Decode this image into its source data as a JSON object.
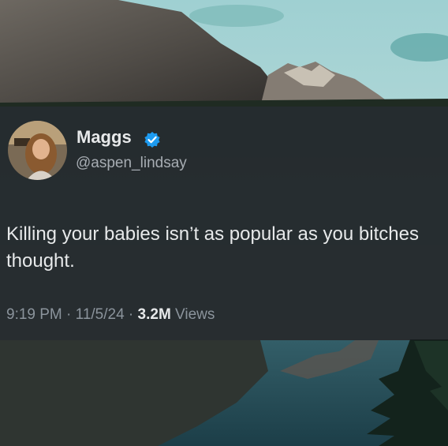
{
  "tweet": {
    "display_name": "Maggs",
    "handle": "@aspen_lindsay",
    "text": "Killing your babies isn’t as popular as you bitches thought.",
    "time": "9:19 PM",
    "date": "11/5/24",
    "separator": " · ",
    "views_count": "3.2M",
    "views_label": " Views",
    "verified_badge_icon": "verified-check-icon",
    "accent_color": "#1d9bf0"
  }
}
